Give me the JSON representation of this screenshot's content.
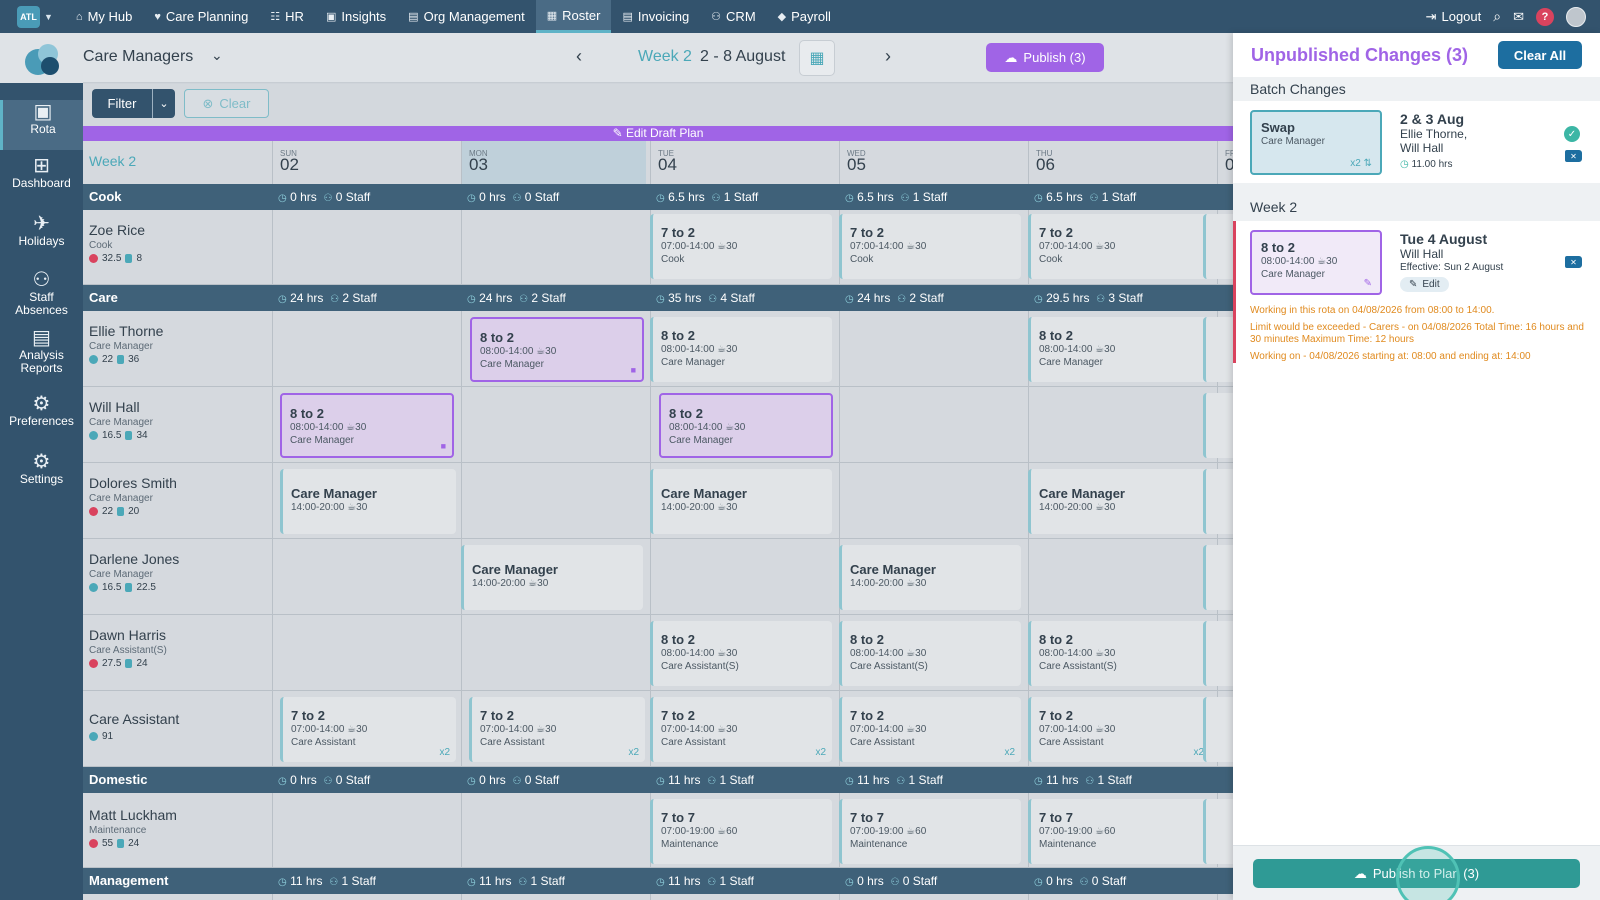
{
  "nav": {
    "badge": "ATL",
    "items": [
      {
        "icon": "home-icon",
        "glyph": "⌂",
        "label": "My Hub"
      },
      {
        "icon": "heart-icon",
        "glyph": "♥",
        "label": "Care Planning"
      },
      {
        "icon": "people-icon",
        "glyph": "☷",
        "label": "HR"
      },
      {
        "icon": "chart-icon",
        "glyph": "▣",
        "label": "Insights"
      },
      {
        "icon": "document-icon",
        "glyph": "▤",
        "label": "Org Management"
      },
      {
        "icon": "calendar-icon",
        "glyph": "▦",
        "label": "Roster"
      },
      {
        "icon": "invoice-icon",
        "glyph": "▤",
        "label": "Invoicing"
      },
      {
        "icon": "crm-icon",
        "glyph": "⚇",
        "label": "CRM"
      },
      {
        "icon": "tag-icon",
        "glyph": "◆",
        "label": "Payroll"
      }
    ],
    "active": "Roster",
    "logout": "Logout",
    "help": "?"
  },
  "sidebar": {
    "items": [
      {
        "label": "Rota",
        "glyph": "▣"
      },
      {
        "label": "Dashboard",
        "glyph": "⊞"
      },
      {
        "label": "Holidays",
        "glyph": "✈"
      },
      {
        "label": "Staff Absences",
        "glyph": "⚇"
      },
      {
        "label": "Analysis Reports",
        "glyph": "▤"
      },
      {
        "label": "Preferences",
        "glyph": "⚙"
      },
      {
        "label": "Settings",
        "glyph": "⚙"
      }
    ]
  },
  "header": {
    "team": "Care Managers",
    "week_label": "Week 2",
    "week_range": "2 - 8 August",
    "publish": "Publish (3)"
  },
  "filters": {
    "filter": "Filter",
    "clear": "Clear"
  },
  "draft_banner": "Edit Draft Plan",
  "grid": {
    "week_col": "Week 2",
    "days": [
      {
        "name": "SUN",
        "date": "02"
      },
      {
        "name": "MON",
        "date": "03"
      },
      {
        "name": "TUE",
        "date": "04"
      },
      {
        "name": "WED",
        "date": "05"
      },
      {
        "name": "THU",
        "date": "06"
      },
      {
        "name": "FR",
        "date": "0"
      }
    ],
    "groups": {
      "cook": {
        "name": "Cook",
        "stats": [
          [
            "0 hrs",
            "0 Staff"
          ],
          [
            "0 hrs",
            "0 Staff"
          ],
          [
            "6.5 hrs",
            "1 Staff"
          ],
          [
            "6.5 hrs",
            "1 Staff"
          ],
          [
            "6.5 hrs",
            "1 Staff"
          ]
        ]
      },
      "care": {
        "name": "Care",
        "stats": [
          [
            "24 hrs",
            "2 Staff"
          ],
          [
            "24 hrs",
            "2 Staff"
          ],
          [
            "35 hrs",
            "4 Staff"
          ],
          [
            "24 hrs",
            "2 Staff"
          ],
          [
            "29.5 hrs",
            "3 Staff"
          ]
        ]
      },
      "domestic": {
        "name": "Domestic",
        "stats": [
          [
            "0 hrs",
            "0 Staff"
          ],
          [
            "0 hrs",
            "0 Staff"
          ],
          [
            "11 hrs",
            "1 Staff"
          ],
          [
            "11 hrs",
            "1 Staff"
          ],
          [
            "11 hrs",
            "1 Staff"
          ]
        ]
      },
      "management": {
        "name": "Management",
        "stats": [
          [
            "11 hrs",
            "1 Staff"
          ],
          [
            "11 hrs",
            "1 Staff"
          ],
          [
            "11 hrs",
            "1 Staff"
          ],
          [
            "0 hrs",
            "0 Staff"
          ],
          [
            "0 hrs",
            "0 Staff"
          ]
        ]
      }
    },
    "employees": {
      "zoe": {
        "name": "Zoe Rice",
        "role": "Cook",
        "s1": "32.5",
        "s2": "8"
      },
      "ellie": {
        "name": "Ellie Thorne",
        "role": "Care Manager",
        "s1": "22",
        "s2": "36"
      },
      "will": {
        "name": "Will Hall",
        "role": "Care Manager",
        "s1": "16.5",
        "s2": "34"
      },
      "dolores": {
        "name": "Dolores Smith",
        "role": "Care Manager",
        "s1": "22",
        "s2": "20"
      },
      "darlene": {
        "name": "Darlene Jones",
        "role": "Care Manager",
        "s1": "16.5",
        "s2": "22.5"
      },
      "dawn": {
        "name": "Dawn Harris",
        "role": "Care Assistant(S)",
        "s1": "27.5",
        "s2": "24"
      },
      "ca": {
        "name": "Care Assistant",
        "role": "",
        "s1": "91",
        "s2": ""
      },
      "matt": {
        "name": "Matt Luckham",
        "role": "Maintenance",
        "s1": "55",
        "s2": "24"
      }
    },
    "shifts": {
      "s7to2": "7 to 2",
      "s8to2": "8 to 2",
      "s7to7": "7 to 7",
      "cm": "Care Manager",
      "t0700": "07:00-14:00",
      "t0800": "08:00-14:00",
      "t1400": "14:00-20:00",
      "t0719": "07:00-19:00",
      "b30": "30",
      "b60": "60",
      "rCook": "Cook",
      "rCM": "Care Manager",
      "rCAS": "Care Assistant(S)",
      "rCA": "Care Assistant",
      "rMaint": "Maintenance",
      "x2": "x2"
    }
  },
  "panel": {
    "title": "Unpublished Changes (3)",
    "clear_all": "Clear All",
    "batch_label": "Batch Changes",
    "batch": {
      "mini_title": "Swap",
      "mini_role": "Care Manager",
      "mini_count": "x2",
      "heading": "2 & 3 Aug",
      "people_1": "Ellie Thorne,",
      "people_2": "Will Hall",
      "hours": "11.00 hrs"
    },
    "week_label": "Week 2",
    "change": {
      "mini_title": "8 to 2",
      "mini_time": "08:00-14:00",
      "mini_break": "30",
      "mini_role": "Care Manager",
      "heading": "Tue 4 August",
      "person": "Will Hall",
      "effective": "Effective: Sun 2 August",
      "edit": "Edit"
    },
    "warnings": {
      "w1": "Working in this rota on 04/08/2026 from 08:00 to 14:00.",
      "w2": "Limit would be exceeded - Carers - on 04/08/2026 Total Time: 16 hours and 30 minutes Maximum Time: 12 hours",
      "w3": "Working on - 04/08/2026 starting at: 08:00 and ending at: 14:00"
    },
    "publish_plan": "Publish to Plan (3)"
  }
}
